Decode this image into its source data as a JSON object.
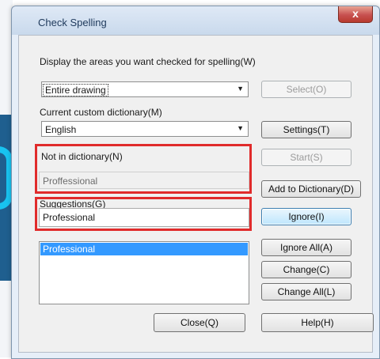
{
  "window": {
    "title": "Check Spelling",
    "close_label": "x"
  },
  "areas": {
    "label": "Display the areas you want checked for spelling(W)",
    "selected": "Entire drawing",
    "select_button": "Select(O)"
  },
  "dictionary": {
    "label": "Current custom dictionary(M)",
    "selected": "English",
    "settings_button": "Settings(T)"
  },
  "not_in_dictionary": {
    "label": "Not in dictionary(N)",
    "value": "Proffessional",
    "start_button": "Start(S)",
    "add_button": "Add to Dictionary(D)"
  },
  "suggestions": {
    "label": "Suggestions(G)",
    "value": "Professional",
    "ignore_button": "Ignore(I)",
    "ignore_all_button": "Ignore All(A)",
    "change_button": "Change(C)",
    "change_all_button": "Change All(L)",
    "items": [
      "Professional"
    ]
  },
  "footer": {
    "close_button": "Close(Q)",
    "help_button": "Help(H)"
  }
}
